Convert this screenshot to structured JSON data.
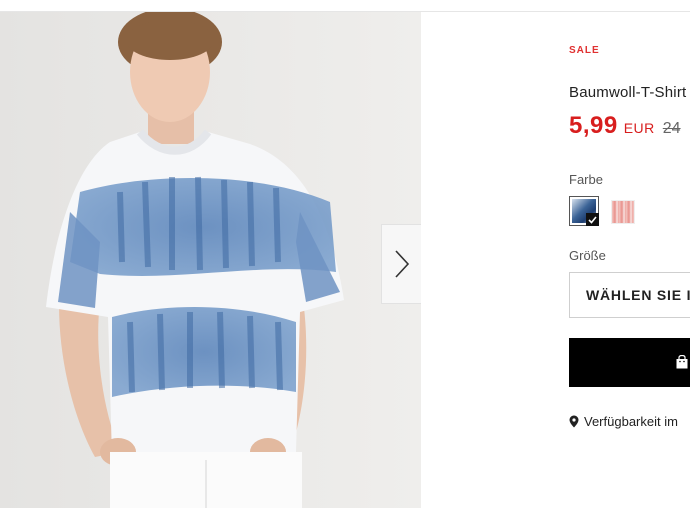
{
  "gallery": {
    "image_alt": "Baumwoll-T-Shirt Batik",
    "next_icon": "chevron-right-icon"
  },
  "product": {
    "badge": "SALE",
    "name": "Baumwoll-T-Shirt",
    "price": "5,99",
    "currency": "EUR",
    "old_price": "24",
    "colors": {
      "label": "Farbe",
      "options": [
        {
          "name": "blue tie-dye",
          "color": "#3c6497",
          "selected": true
        },
        {
          "name": "pink tie-dye",
          "color": "#e8908a",
          "selected": false
        }
      ]
    },
    "size": {
      "label": "Größe",
      "select_label": "WÄHLEN SIE IH"
    },
    "add_to_cart_icon": "shopping-bag-icon",
    "availability": {
      "icon": "location-pin-icon",
      "text": "Verfügbarkeit im"
    }
  },
  "colors": {
    "sale": "#e03131",
    "price": "#d81e1e",
    "cart_button": "#000000"
  }
}
